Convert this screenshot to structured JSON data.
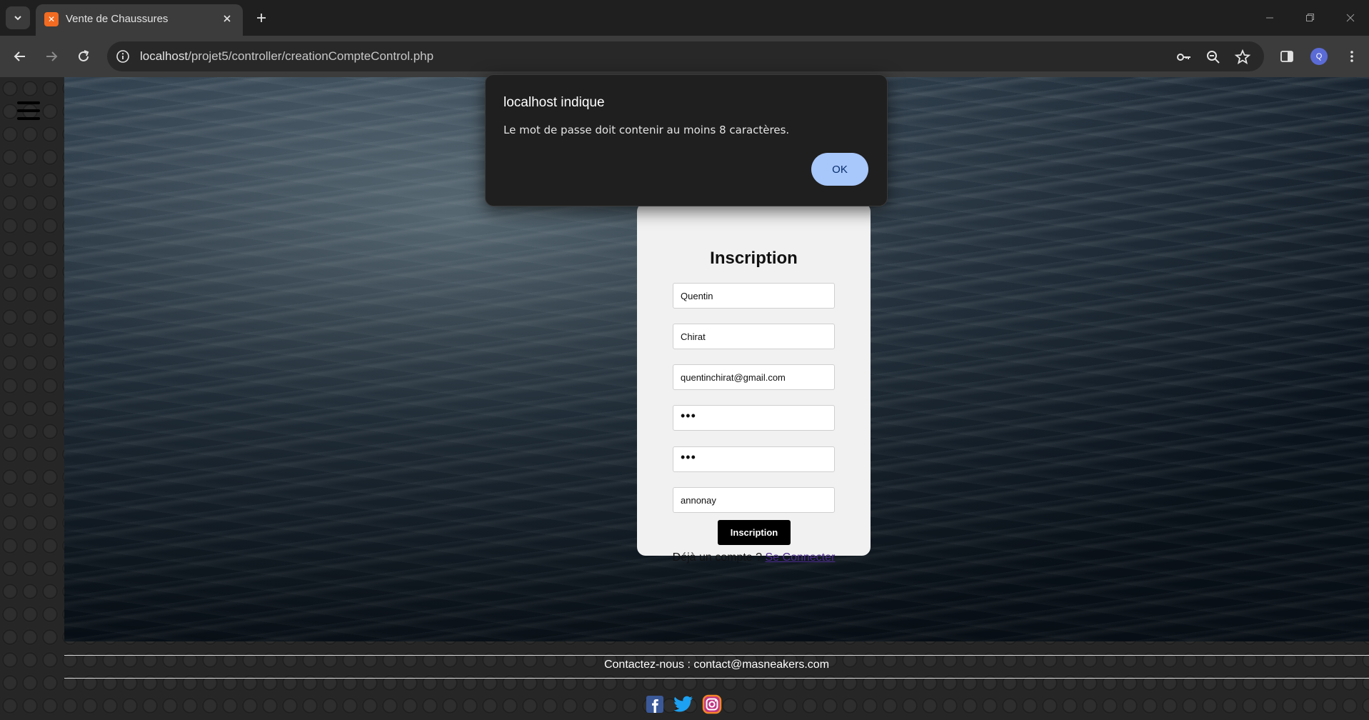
{
  "browser": {
    "tab_title": "Vente de Chaussures",
    "url_host": "localhost",
    "url_path": "/projet5/controller/creationCompteControl.php",
    "profile_initial": "Q",
    "icons": [
      "chevron-down-icon",
      "xampp-favicon",
      "close-icon",
      "plus-icon",
      "minimize-icon",
      "restore-icon",
      "back-icon",
      "forward-icon",
      "reload-icon",
      "info-icon",
      "key-icon",
      "zoom-icon",
      "star-icon",
      "sidepanel-icon",
      "menu-dots-icon"
    ]
  },
  "page": {
    "hamburger_icon": "hamburger-icon",
    "form": {
      "title": "Inscription",
      "fields": {
        "first_name": "Quentin",
        "last_name": "Chirat",
        "email": "quentinchirat@gmail.com",
        "password": "•••",
        "password_confirm": "•••",
        "city": "annonay"
      },
      "submit_label": "Inscription",
      "login_prompt": "Déjà un compte ?",
      "login_link": "Se Connecter"
    },
    "footer": {
      "contact": "Contactez-nous : contact@masneakers.com",
      "social_icons": [
        "facebook-icon",
        "twitter-icon",
        "instagram-icon"
      ]
    }
  },
  "dialog": {
    "title": "localhost indique",
    "message": "Le mot de passe doit contenir au moins 8 caractères.",
    "ok_label": "OK"
  },
  "colors": {
    "dialog_ok": "#a8c7fa",
    "link": "#4b2a8c",
    "button": "#000000"
  }
}
